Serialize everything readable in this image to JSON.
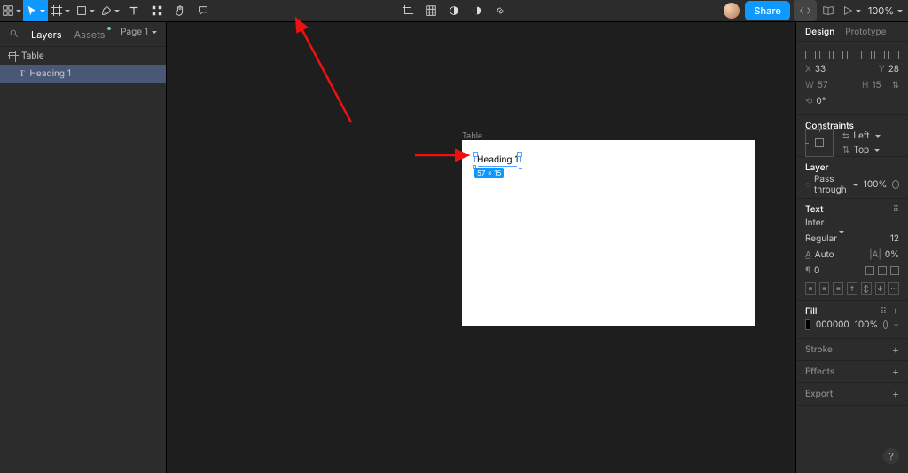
{
  "toolbar": {
    "share": "Share",
    "zoom": "100%"
  },
  "left": {
    "tab_layers": "Layers",
    "tab_assets": "Assets",
    "page_selector": "Page 1",
    "frame_name": "Table",
    "selected_layer": "Heading 1"
  },
  "canvas": {
    "frame_label": "Table",
    "text_content": "Heading 1",
    "dim_badge": "57 × 15"
  },
  "right": {
    "tab_design": "Design",
    "tab_prototype": "Prototype",
    "x_label": "X",
    "x_value": "33",
    "y_label": "Y",
    "y_value": "28",
    "w_label": "W",
    "w_value": "57",
    "h_label": "H",
    "h_value": "15",
    "rotation_label": "⟲",
    "rotation_value": "0°",
    "constraints_title": "Constraints",
    "constraint_h": "Left",
    "constraint_v": "Top",
    "layer_title": "Layer",
    "blend_mode": "Pass through",
    "layer_opacity": "100%",
    "text_title": "Text",
    "font_family": "Inter",
    "font_weight": "Regular",
    "font_size": "12",
    "line_height_label": "Auto",
    "letter_spacing": "0%",
    "paragraph_spacing": "0",
    "fill_title": "Fill",
    "fill_hex": "000000",
    "fill_opacity": "100%",
    "stroke_title": "Stroke",
    "effects_title": "Effects",
    "export_title": "Export"
  },
  "help": "?"
}
